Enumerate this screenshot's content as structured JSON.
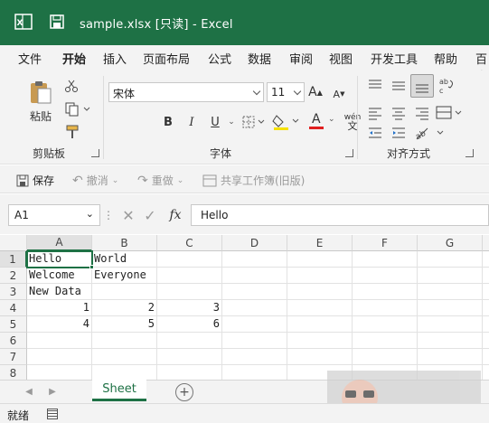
{
  "window": {
    "title": "sample.xlsx  [只读]  -  Excel"
  },
  "ribbon_tabs": [
    "文件",
    "开始",
    "插入",
    "页面布局",
    "公式",
    "数据",
    "审阅",
    "视图",
    "开发工具",
    "帮助",
    "百度"
  ],
  "ribbon": {
    "clipboard": {
      "paste_label": "粘贴",
      "group_label": "剪贴板"
    },
    "font": {
      "font_name": "宋体",
      "font_size": "11",
      "group_label": "字体",
      "bold": "B",
      "italic": "I",
      "underline": "U",
      "increase": "A",
      "decrease": "A",
      "font_color": "A",
      "phonetic": "wén"
    },
    "alignment": {
      "group_label": "对齐方式"
    }
  },
  "quick_access": {
    "save": "保存",
    "undo": "撤消",
    "redo": "重做",
    "share": "共享工作簿(旧版)"
  },
  "formula_bar": {
    "name_box": "A1",
    "fx": "fx",
    "value": "Hello"
  },
  "grid": {
    "columns": [
      "A",
      "B",
      "C",
      "D",
      "E",
      "F",
      "G"
    ],
    "rows": [
      "1",
      "2",
      "3",
      "4",
      "5",
      "6",
      "7",
      "8"
    ],
    "cells": {
      "A1": "Hello",
      "B1": "World",
      "A2": "Welcome",
      "B2": "Everyone",
      "A3": "New Data",
      "A4": "1",
      "B4": "2",
      "C4": "3",
      "A5": "4",
      "B5": "5",
      "C5": "6"
    }
  },
  "sheets": {
    "active": "Sheet"
  },
  "status": {
    "ready": "就绪"
  },
  "colors": {
    "brand": "#1e7145",
    "ribbon_bg": "#f3f3f3"
  }
}
